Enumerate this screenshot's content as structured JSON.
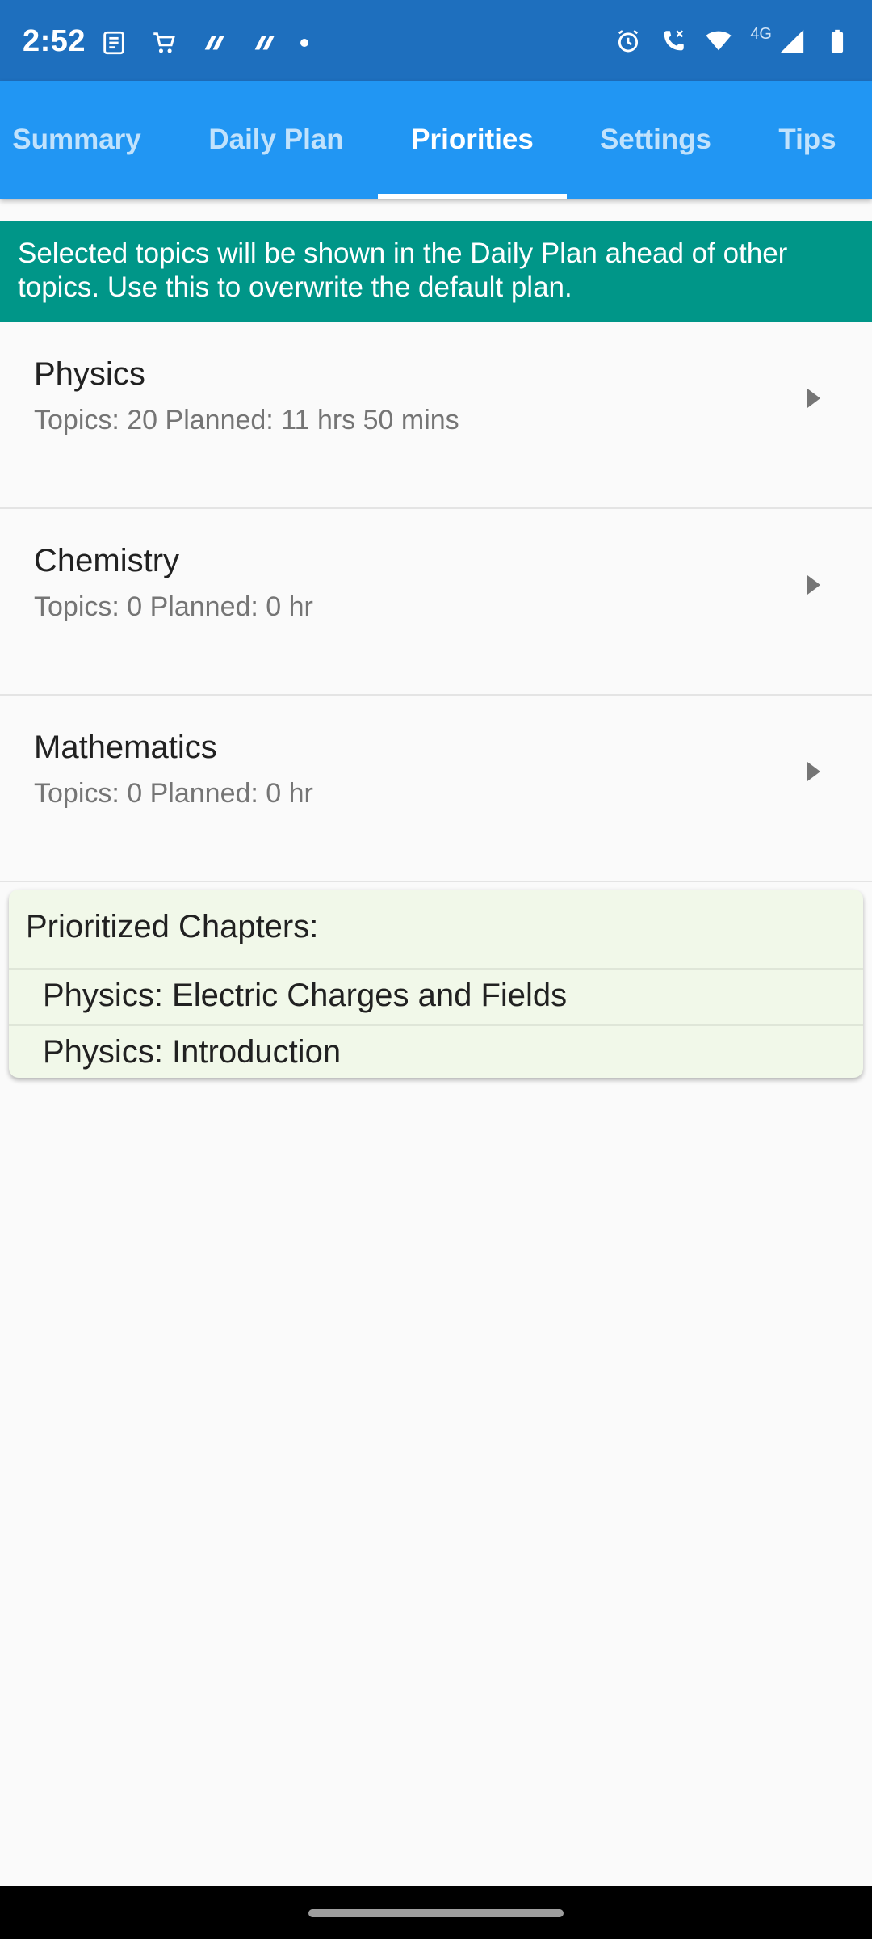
{
  "status_bar": {
    "time": "2:52",
    "network_label": "4G",
    "left_icons": [
      "news-icon",
      "cart-icon",
      "app-icon",
      "app-icon",
      "dot-icon"
    ],
    "right_icons": [
      "alarm-icon",
      "call-icon",
      "wifi-icon",
      "signal-icon",
      "battery-icon"
    ]
  },
  "tabs": [
    {
      "label": "Summary",
      "active": false
    },
    {
      "label": "Daily Plan",
      "active": false
    },
    {
      "label": "Priorities",
      "active": true
    },
    {
      "label": "Settings",
      "active": false
    },
    {
      "label": "Tips",
      "active": false
    }
  ],
  "banner": {
    "text": "Selected topics will be shown in the Daily Plan ahead of other topics. Use this to overwrite the default plan."
  },
  "subjects": [
    {
      "name": "Physics",
      "meta": "Topics: 20 Planned: 11 hrs 50 mins"
    },
    {
      "name": "Chemistry",
      "meta": "Topics: 0 Planned: 0 hr"
    },
    {
      "name": "Mathematics",
      "meta": "Topics: 0 Planned: 0 hr"
    }
  ],
  "prioritized": {
    "title": "Prioritized Chapters:",
    "items": [
      "Physics: Electric Charges and Fields",
      "Physics: Introduction"
    ]
  },
  "colors": {
    "status_bar": "#1e6fbe",
    "app_bar": "#2196f3",
    "banner": "#009688",
    "card": "#f1f8e9"
  }
}
